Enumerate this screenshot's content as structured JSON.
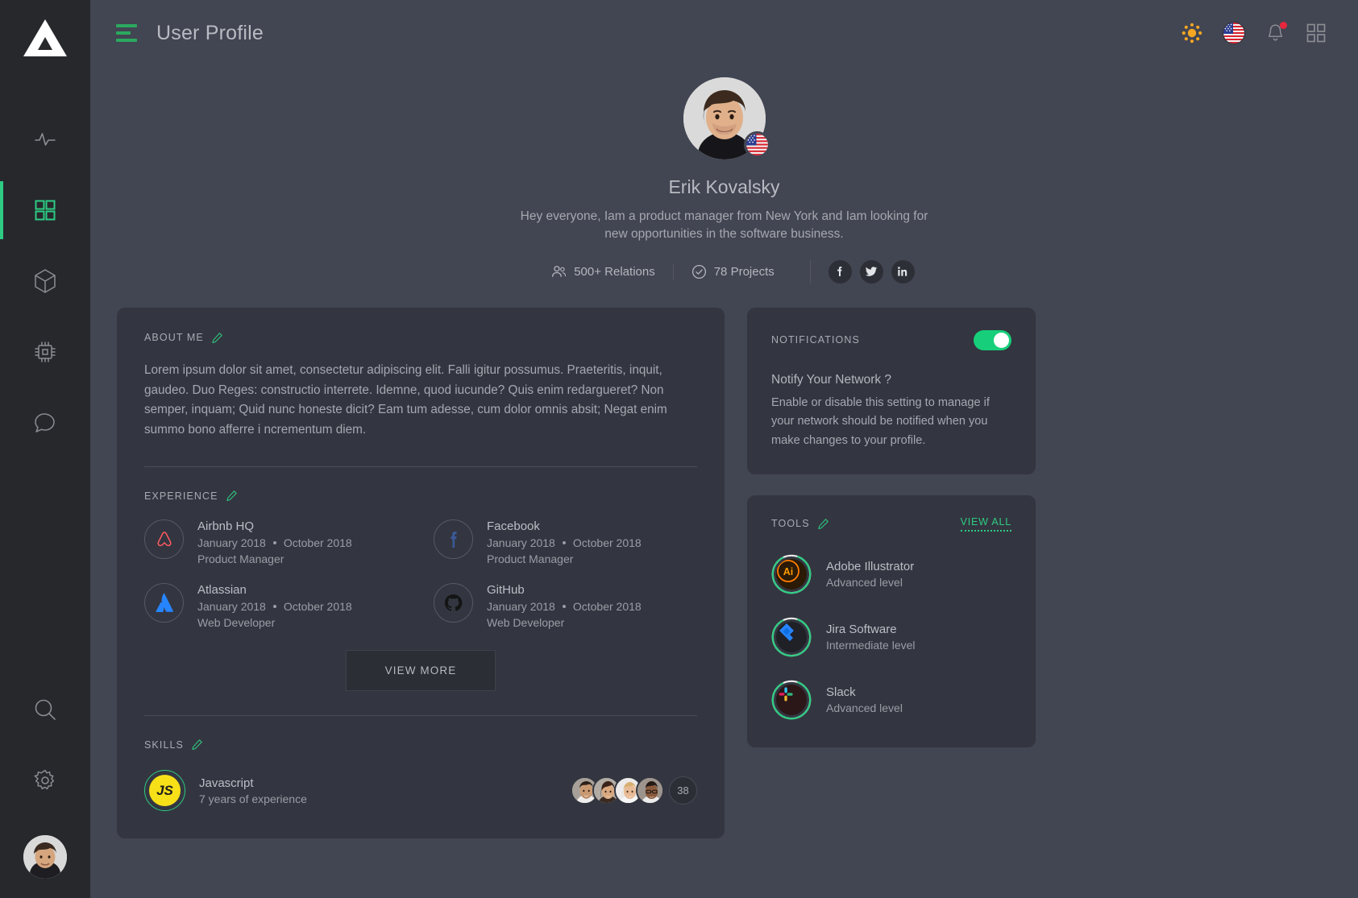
{
  "app": {
    "logo_icon": "triangle-logo",
    "accent_color": "#2ecc83",
    "background_color": "#424552",
    "card_color": "#333640",
    "sidebar_color": "#26282c"
  },
  "sidebar": {
    "items": [
      {
        "icon": "activity-pulse-icon",
        "name": "activity",
        "active": false
      },
      {
        "icon": "grid-dashboard-icon",
        "name": "dashboard",
        "active": true
      },
      {
        "icon": "cube-icon",
        "name": "packages",
        "active": false
      },
      {
        "icon": "cpu-chip-icon",
        "name": "hardware",
        "active": false
      },
      {
        "icon": "chat-bubble-icon",
        "name": "messages",
        "active": false
      }
    ],
    "bottom": [
      {
        "icon": "search-icon",
        "name": "search"
      },
      {
        "icon": "gear-icon",
        "name": "settings"
      }
    ],
    "avatar_alt": "user-avatar"
  },
  "topbar": {
    "menu_icon": "hamburger-menu-icon",
    "title": "User Profile",
    "actions": [
      {
        "icon": "sun-theme-icon",
        "name": "theme-toggle"
      },
      {
        "icon": "us-flag-icon",
        "name": "language-selector"
      },
      {
        "icon": "bell-icon",
        "name": "notifications",
        "badge": true
      },
      {
        "icon": "grid-apps-icon",
        "name": "apps-menu"
      }
    ]
  },
  "profile": {
    "name": "Erik Kovalsky",
    "bio": "Hey everyone,  Iam a product manager from New York and Iam looking for new opportunities in the software business.",
    "country_flag": "us-flag-icon",
    "stats": [
      {
        "icon": "users-icon",
        "label": "500+ Relations"
      },
      {
        "icon": "check-circle-icon",
        "label": "78 Projects"
      }
    ],
    "socials": [
      {
        "icon": "facebook-icon",
        "name": "facebook"
      },
      {
        "icon": "twitter-icon",
        "name": "twitter"
      },
      {
        "icon": "linkedin-icon",
        "name": "linkedin"
      }
    ]
  },
  "about": {
    "label": "ABOUT ME",
    "edit_icon": "pencil-icon",
    "text": "Lorem ipsum dolor sit amet, consectetur adipiscing elit. Falli igitur possumus. Praeteritis, inquit, gaudeo. Duo Reges: constructio interrete. Idemne, quod iucunde? Quis enim redargueret? Non semper, inquam; Quid nunc honeste dicit? Eam tum adesse, cum dolor omnis absit; Negat enim summo bono afferre i ncrementum diem."
  },
  "experience": {
    "label": "EXPERIENCE",
    "edit_icon": "pencil-icon",
    "items": [
      {
        "company": "Airbnb HQ",
        "start": "January 2018",
        "end": "October 2018",
        "role": "Product Manager",
        "logo": "airbnb-icon"
      },
      {
        "company": "Facebook",
        "start": "January 2018",
        "end": "October 2018",
        "role": "Product Manager",
        "logo": "facebook-icon"
      },
      {
        "company": "Atlassian",
        "start": "January 2018",
        "end": "October 2018",
        "role": "Web Developer",
        "logo": "atlassian-icon"
      },
      {
        "company": "GitHub",
        "start": "January 2018",
        "end": "October 2018",
        "role": "Web Developer",
        "logo": "github-icon"
      }
    ],
    "view_more_label": "VIEW MORE"
  },
  "skills": {
    "label": "SKILLS",
    "edit_icon": "pencil-icon",
    "items": [
      {
        "badge_text": "JS",
        "name": "Javascript",
        "experience": "7 years of experience",
        "collaborator_count": "38",
        "collaborators": [
          "avatar-1",
          "avatar-2",
          "avatar-3",
          "avatar-4"
        ]
      }
    ]
  },
  "notifications_card": {
    "label": "NOTIFICATIONS",
    "toggle_on": true,
    "question": "Notify Your Network ?",
    "description": "Enable or disable this setting to manage if your network should be notified when you make changes to your profile."
  },
  "tools_card": {
    "label": "TOOLS",
    "edit_icon": "pencil-icon",
    "view_all_label": "VIEW ALL",
    "items": [
      {
        "name": "Adobe Illustrator",
        "level": "Advanced level",
        "icon": "adobe-illustrator-icon",
        "progress": 88
      },
      {
        "name": "Jira Software",
        "level": "Intermediate level",
        "icon": "jira-icon",
        "progress": 88
      },
      {
        "name": "Slack",
        "level": "Advanced level",
        "icon": "slack-icon",
        "progress": 88
      }
    ]
  }
}
